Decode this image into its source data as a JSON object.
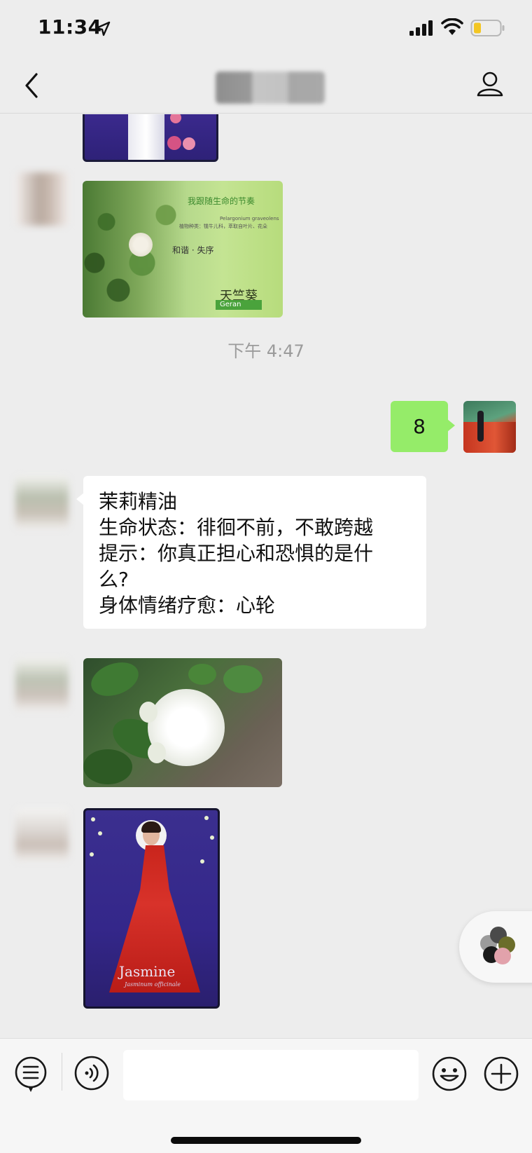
{
  "status_bar": {
    "time": "11:34"
  },
  "nav": {
    "title": ""
  },
  "chat": {
    "timestamp": "下午 4:47",
    "my_message": "8",
    "geranium_card": {
      "title": "我跟随生命的节奏",
      "latin": "Pelargonium graveolens",
      "desc": "植物种类：牻牛儿科，萃取自叶片、花朵",
      "theme": "和谐 · 失序",
      "name": "天竺葵",
      "banner": "Geran"
    },
    "text_message": {
      "lines": [
        "茉莉精油",
        "生命状态：徘徊不前，不敢跨越",
        "提示：你真正担心和恐惧的是什",
        "么?",
        "身体情绪疗愈：心轮"
      ]
    },
    "jasmine_card": {
      "name": "Jasmine",
      "latin": "Jasminum officinale"
    }
  },
  "input_bar": {
    "placeholder": ""
  },
  "colors": {
    "background": "#ededed",
    "my_bubble": "#95ec69",
    "other_bubble": "#ffffff",
    "timestamp": "#9b9b9b"
  }
}
